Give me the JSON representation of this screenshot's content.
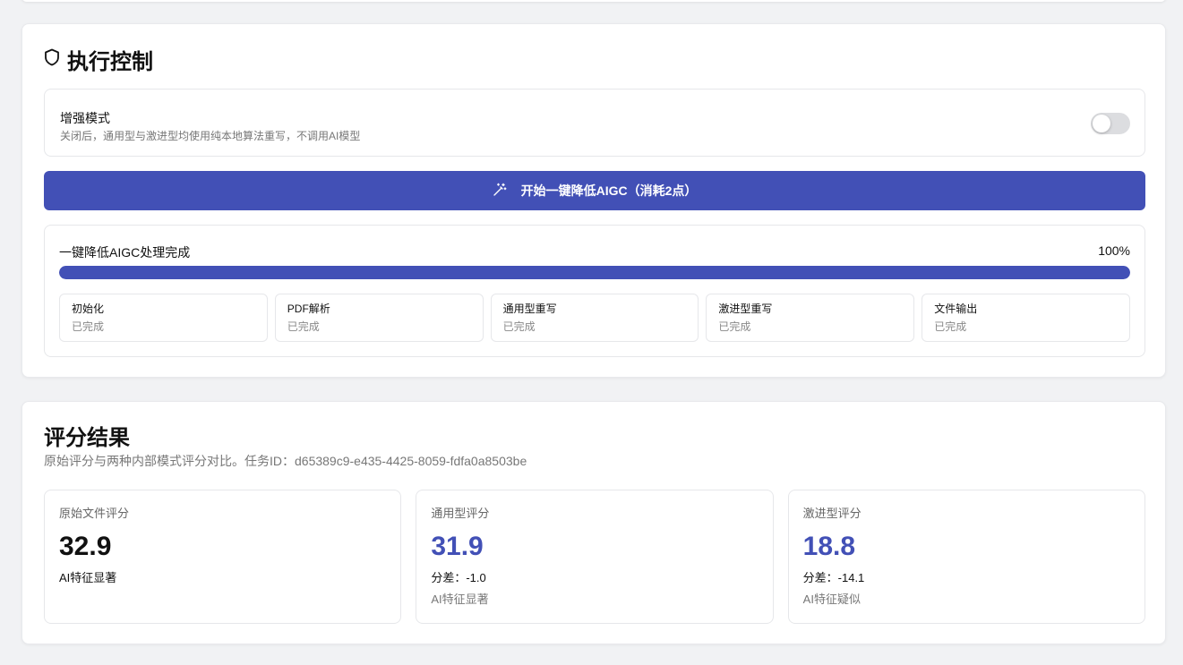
{
  "execution": {
    "title": "执行控制",
    "enhanced_mode": {
      "label": "增强模式",
      "description": "关闭后，通用型与激进型均使用纯本地算法重写，不调用AI模型",
      "enabled": false
    },
    "run_button_label": "开始一键降低AIGC（消耗2点）",
    "progress": {
      "label": "一键降低AIGC处理完成",
      "percent_text": "100%",
      "value": 1.0
    },
    "steps": [
      {
        "name": "初始化",
        "status": "已完成"
      },
      {
        "name": "PDF解析",
        "status": "已完成"
      },
      {
        "name": "通用型重写",
        "status": "已完成"
      },
      {
        "name": "激进型重写",
        "status": "已完成"
      },
      {
        "name": "文件输出",
        "status": "已完成"
      }
    ]
  },
  "scores": {
    "title": "评分结果",
    "subtitle": "原始评分与两种内部模式评分对比。任务ID：d65389c9-e435-4425-8059-fdfa0a8503be",
    "cards": [
      {
        "label": "原始文件评分",
        "value": "32.9",
        "diff": "",
        "level": "AI特征显著",
        "value_color": "#111111"
      },
      {
        "label": "通用型评分",
        "value": "31.9",
        "diff": "分差：-1.0",
        "level": "AI特征显著",
        "value_color": "#4250b6"
      },
      {
        "label": "激进型评分",
        "value": "18.8",
        "diff": "分差：-14.1",
        "level": "AI特征疑似",
        "value_color": "#4250b6"
      }
    ]
  },
  "colors": {
    "accent": "#4250b6",
    "background": "#f1f2f4",
    "toggle_off": "#dcdde0"
  },
  "icons": {
    "section": "shield-icon",
    "run_button": "magic-wand-icon"
  }
}
